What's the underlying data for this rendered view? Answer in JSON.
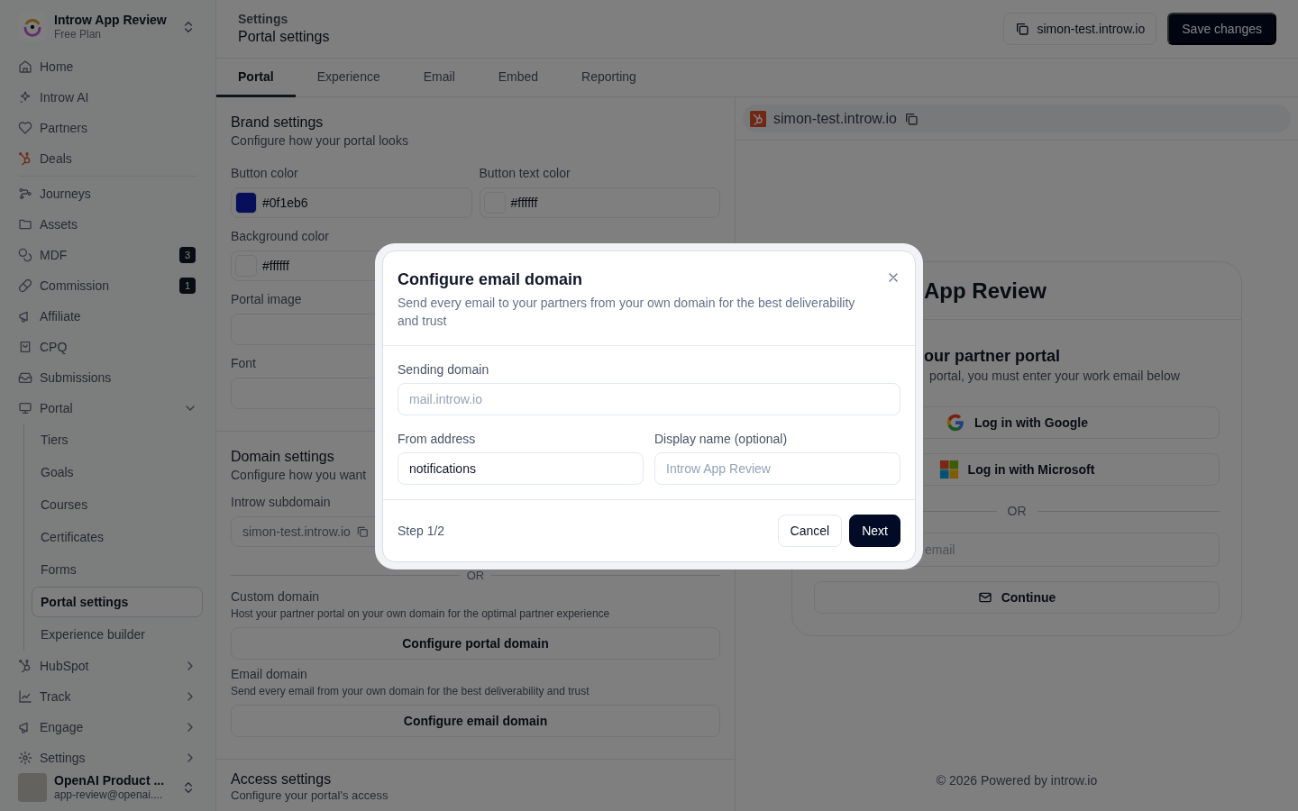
{
  "sidebar": {
    "workspace": {
      "name": "Introw App Review",
      "plan": "Free Plan"
    },
    "sections": [
      {
        "items": [
          {
            "label": "Home",
            "selected": false
          },
          {
            "label": "Introw AI",
            "selected": false
          },
          {
            "label": "Partners",
            "selected": false
          },
          {
            "label": "Deals",
            "selected": false
          }
        ]
      },
      {
        "items": [
          {
            "label": "Journeys",
            "selected": false
          },
          {
            "label": "Assets",
            "selected": false
          },
          {
            "label": "MDF",
            "badge": "3",
            "selected": false
          },
          {
            "label": "Commission",
            "badge": "1",
            "selected": false
          },
          {
            "label": "Affiliate",
            "selected": false
          },
          {
            "label": "CPQ",
            "selected": false
          },
          {
            "label": "Submissions",
            "selected": false
          },
          {
            "label": "Portal",
            "selected": false,
            "expanded": true,
            "children": [
              {
                "label": "Tiers",
                "selected": false
              },
              {
                "label": "Goals",
                "selected": false
              },
              {
                "label": "Courses",
                "selected": false
              },
              {
                "label": "Certificates",
                "selected": false
              },
              {
                "label": "Forms",
                "selected": false
              },
              {
                "label": "Portal settings",
                "selected": true
              },
              {
                "label": "Experience builder",
                "selected": false
              }
            ]
          },
          {
            "label": "HubSpot",
            "selected": false,
            "expanded": false
          },
          {
            "label": "Track",
            "selected": false,
            "expanded": false
          },
          {
            "label": "Engage",
            "selected": false,
            "expanded": false
          },
          {
            "label": "Settings",
            "selected": false,
            "expanded": false
          }
        ]
      }
    ],
    "user": {
      "name": "OpenAI Product ...",
      "email": "app-review@openai...."
    }
  },
  "header": {
    "breadcrumb": "Settings",
    "title": "Portal settings",
    "domain_button": "simon-test.introw.io",
    "save_button": "Save changes"
  },
  "tabs": [
    {
      "label": "Portal",
      "selected": true
    },
    {
      "label": "Experience",
      "selected": false
    },
    {
      "label": "Email",
      "selected": false
    },
    {
      "label": "Embed",
      "selected": false
    },
    {
      "label": "Reporting",
      "selected": false
    }
  ],
  "brand_settings": {
    "title": "Brand settings",
    "subtitle": "Configure how your portal looks",
    "fields": [
      {
        "kind": "color",
        "label": "Button color",
        "value": "#0f1eb6"
      },
      {
        "kind": "color",
        "label": "Button text color",
        "value": "#ffffff"
      },
      {
        "kind": "color",
        "label": "Background color",
        "value": "#ffffff"
      },
      {
        "kind": "upload",
        "label": "Portal image"
      },
      {
        "kind": "select",
        "label": "Font"
      }
    ]
  },
  "domain_settings": {
    "title": "Domain settings",
    "subtitle": "Configure how you want",
    "subdomain": {
      "label": "Introw subdomain",
      "value": "simon-test.introw.io"
    },
    "separator": "OR",
    "options": [
      {
        "label": "Custom domain",
        "description": "Host your partner portal on your own domain for the optimal partner experience",
        "button": "Configure portal domain"
      },
      {
        "label": "Email domain",
        "description": "Send every email from your own domain for the best deliverability and trust",
        "button": "Configure email domain"
      }
    ]
  },
  "access_settings": {
    "title": "Access settings",
    "subtitle": "Configure your portal's access"
  },
  "preview": {
    "url": "simon-test.introw.io",
    "card": {
      "title": "App Review",
      "heading": "our partner portal",
      "text": "portal, you must enter your work email below",
      "buttons": [
        {
          "kind": "google",
          "label": "Log in with Google"
        },
        {
          "kind": "microsoft",
          "label": "Log in with Microsoft"
        }
      ],
      "separator": "OR",
      "email_placeholder": "email",
      "continue_button": "Continue"
    },
    "footer": "© 2026 Powered by introw.io"
  },
  "modal": {
    "title": "Configure email domain",
    "description": "Send every email to your partners from your own domain for the best deliverability and trust",
    "fields": [
      {
        "label": "Sending domain",
        "placeholder": "mail.introw.io"
      },
      {
        "label": "From address",
        "value": "notifications"
      },
      {
        "label": "Display name (optional)",
        "placeholder": "Introw App Review"
      }
    ],
    "step": "Step 1/2",
    "buttons": [
      {
        "kind": "secondary",
        "label": "Cancel"
      },
      {
        "kind": "primary",
        "label": "Next"
      }
    ]
  }
}
